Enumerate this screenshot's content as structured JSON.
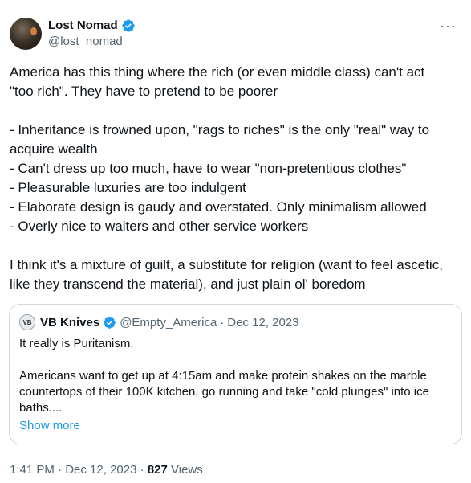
{
  "author": {
    "display_name": "Lost Nomad",
    "handle": "@lost_nomad__"
  },
  "more_icon": "···",
  "body": {
    "intro": [
      "America has this thing where the rich (or even middle class) can't act",
      "\"too rich\". They have to pretend to be poorer"
    ],
    "bullets": [
      "- Inheritance is frowned upon, \"rags to riches\" is the only \"real\" way to",
      "acquire wealth",
      "- Can't dress up too much, have to wear \"non-pretentious clothes\"",
      "- Pleasurable luxuries are too indulgent",
      "- Elaborate design is gaudy and overstated. Only minimalism allowed",
      "- Overly nice to waiters and other service workers"
    ],
    "closing": [
      "I think it's a mixture of guilt, a substitute for religion (want to feel ascetic,",
      "like they transcend the material), and just plain ol' boredom"
    ]
  },
  "quote": {
    "avatar_text": "VB",
    "display_name": "VB Knives",
    "handle": "@Empty_America",
    "separator": "·",
    "date": "Dec 12, 2023",
    "line1": "It really is Puritanism.",
    "paragraph": [
      "Americans want to get up at 4:15am and make protein shakes on the marble",
      "countertops of their 100K kitchen, go running and take \"cold plunges\" into ice",
      "baths...."
    ],
    "show_more": "Show more"
  },
  "footer": {
    "time": "1:41 PM",
    "separator": "·",
    "date": "Dec 12, 2023",
    "separator2": "·",
    "views_count": "827",
    "views_label": "Views"
  },
  "colors": {
    "verified": "#1d9bf0",
    "link": "#1d9bf0",
    "muted": "#536471"
  }
}
